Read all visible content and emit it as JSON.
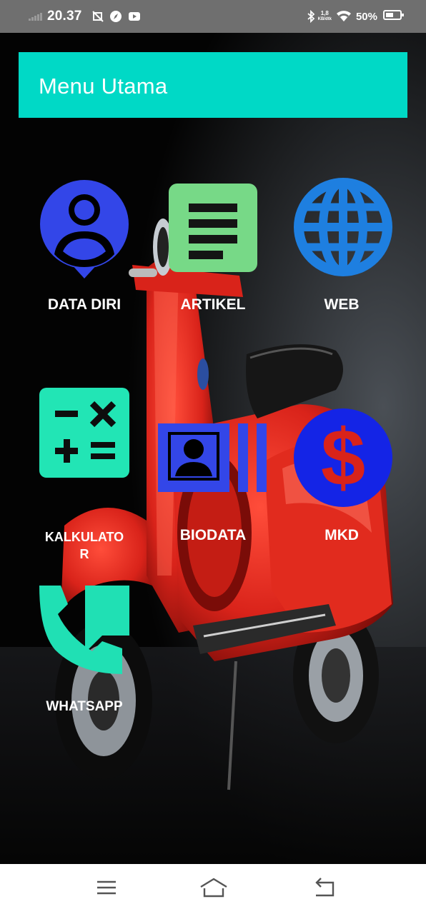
{
  "status_bar": {
    "time": "20.37",
    "network_speed_value": "1,8",
    "network_speed_unit": "KB/dtk",
    "battery_percent": "50%"
  },
  "header": {
    "title": "Menu Utama",
    "background_color": "#00d9c6"
  },
  "menu": {
    "items": [
      {
        "label": "DATA DIRI",
        "icon": "person-pin-icon",
        "color": "#3346e8"
      },
      {
        "label": "ARTIKEL",
        "icon": "article-icon",
        "color": "#77d987"
      },
      {
        "label": "WEB",
        "icon": "globe-icon",
        "color": "#1e7fe0"
      },
      {
        "label": "KALKULATOR",
        "label_lines": [
          "KALKULATO",
          "R"
        ],
        "icon": "calculator-icon",
        "color": "#22e5b5"
      },
      {
        "label": "BIODATA",
        "icon": "contact-card-icon",
        "color": "#3346e8"
      },
      {
        "label": "MKD",
        "icon": "dollar-icon",
        "color": "#1424e6"
      },
      {
        "label": "WHATSAPP",
        "icon": "phone-chat-icon",
        "color": "#20e0b4"
      }
    ]
  },
  "nav_bar": {
    "buttons": [
      "menu",
      "home",
      "back"
    ]
  }
}
